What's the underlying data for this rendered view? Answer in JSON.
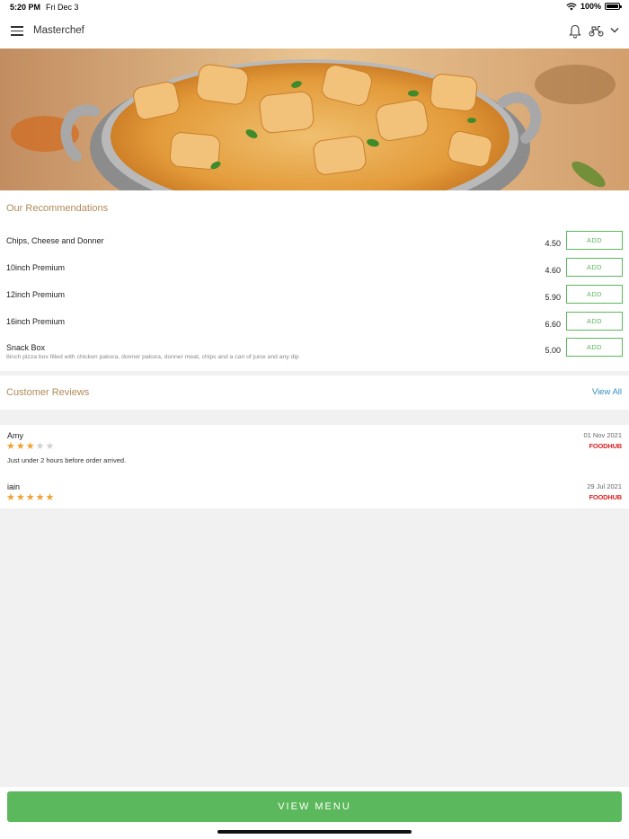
{
  "status_bar": {
    "time": "5:20 PM",
    "date": "Fri Dec 3",
    "battery": "100%",
    "battery_level": 1.0
  },
  "header": {
    "title": "Masterchef",
    "icons": [
      "menu-icon",
      "bell-icon",
      "scooter-icon",
      "chevron-down-icon"
    ]
  },
  "recommendations": {
    "title": "Our Recommendations",
    "items": [
      {
        "name": "Chips, Cheese and Donner",
        "description": "",
        "price": "4.50",
        "button": "ADD"
      },
      {
        "name": "10inch Premium",
        "description": "",
        "price": "4.60",
        "button": "ADD"
      },
      {
        "name": "12inch Premium",
        "description": "",
        "price": "5.90",
        "button": "ADD"
      },
      {
        "name": "16inch Premium",
        "description": "",
        "price": "6.60",
        "button": "ADD"
      },
      {
        "name": "Snack Box",
        "description": "8inch pizza box filled with chicken pakora, donner pakora, donner meat, chips and a can of juice and any dip",
        "price": "5.00",
        "button": "ADD"
      }
    ]
  },
  "reviews": {
    "title": "Customer Reviews",
    "view_all": "View All",
    "items": [
      {
        "name": "Amy",
        "rating": 3,
        "max_rating": 5,
        "text": "Just under 2 hours before order arrived.",
        "date": "01 Nov 2021",
        "source": "FOODHUB"
      },
      {
        "name": "iain",
        "rating": 5,
        "max_rating": 5,
        "text": "",
        "date": "29 Jul 2021",
        "source": "FOODHUB"
      }
    ]
  },
  "footer": {
    "view_menu": "VIEW MENU"
  },
  "colors": {
    "accent_green": "#5cb85c",
    "section_title": "#b08a5a",
    "link_blue": "#2f8fbf",
    "star": "#f0a030",
    "brand_red": "#dd2222"
  }
}
